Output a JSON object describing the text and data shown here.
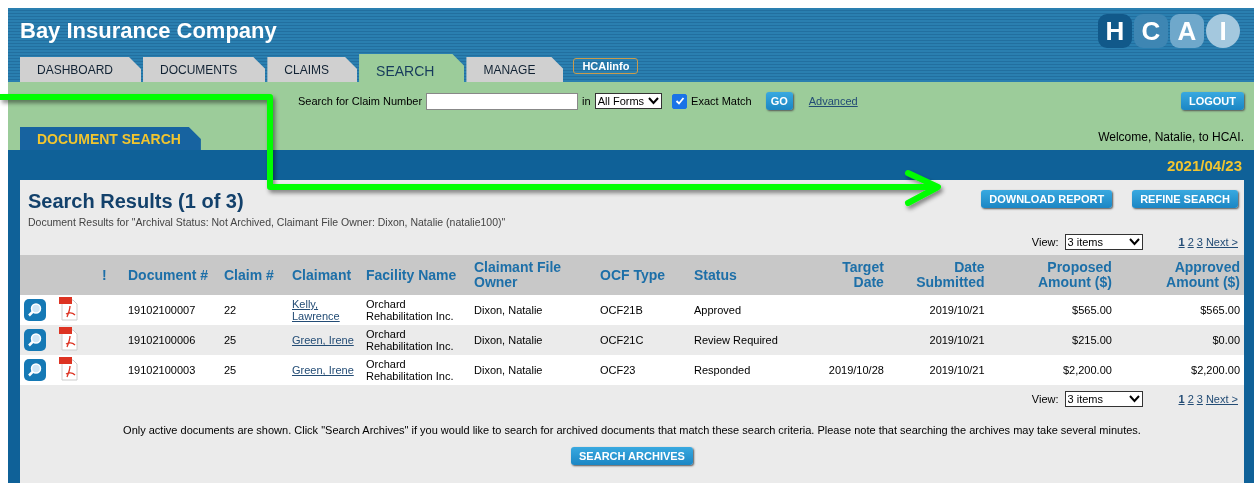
{
  "header": {
    "title": "Bay Insurance Company",
    "logo_letters": [
      "H",
      "C",
      "A",
      "I"
    ]
  },
  "tabs": [
    {
      "label": "DASHBOARD",
      "selected": false
    },
    {
      "label": "DOCUMENTS",
      "selected": false
    },
    {
      "label": "CLAIMS",
      "selected": false
    },
    {
      "label": "SEARCH",
      "selected": true
    },
    {
      "label": "MANAGE",
      "selected": false
    }
  ],
  "info_button": "HCAIinfo",
  "claim_search": {
    "label": "Search for Claim Number",
    "in_label": "in",
    "form_select": "All Forms",
    "exact_match": {
      "label": "Exact Match",
      "checked": true
    },
    "go_button": "GO",
    "advanced_link": "Advanced"
  },
  "logout_button": "LOGOUT",
  "welcome": "Welcome, Natalie, to HCAI.",
  "section_tab": "DOCUMENT SEARCH",
  "date": "2021/04/23",
  "results": {
    "title": "Search Results (1 of 3)",
    "subtitle": "Document Results for \"Archival Status: Not Archived, Claimant File Owner: Dixon, Natalie (natalie100)\"",
    "buttons": [
      "DOWNLOAD REPORT",
      "REFINE SEARCH"
    ],
    "view_label": "View:",
    "view_select": "3 items",
    "pages": [
      {
        "label": "1",
        "selected": true
      },
      {
        "label": "2",
        "selected": false
      },
      {
        "label": "3",
        "selected": false
      }
    ],
    "next_link": "Next >"
  },
  "table": {
    "columns": [
      "!",
      "Document #",
      "Claim #",
      "Claimant",
      "Facility Name",
      "Claimant File Owner",
      "OCF Type",
      "Status",
      "Target Date",
      "Date Submitted",
      "Proposed Amount ($)",
      "Approved Amount ($)"
    ],
    "rows": [
      {
        "document": "19102100007",
        "claim": "22",
        "claimant": "Kelly, Lawrence",
        "facility": "Orchard Rehabilitation Inc.",
        "owner": "Dixon, Natalie",
        "ocf_type": "OCF21B",
        "status": "Approved",
        "submitted": "2019/10/21",
        "proposed": "$565.00",
        "approved": "$565.00"
      },
      {
        "document": "19102100006",
        "claim": "25",
        "claimant": "Green, Irene",
        "facility": "Orchard Rehabilitation Inc.",
        "owner": "Dixon, Natalie",
        "ocf_type": "OCF21C",
        "status": "Review Required",
        "submitted": "2019/10/21",
        "proposed": "$215.00",
        "approved": "$0.00"
      },
      {
        "document": "19102100003",
        "claim": "25",
        "claimant": "Green, Irene",
        "facility": "Orchard Rehabilitation Inc.",
        "owner": "Dixon, Natalie",
        "ocf_type": "OCF23",
        "status": "Responded",
        "target": "2019/10/28",
        "submitted": "2019/10/21",
        "proposed": "$2,200.00",
        "approved": "$2,200.00"
      }
    ]
  },
  "bottom_pager": {
    "view_label": "View:",
    "view_select": "3 items",
    "pages": [
      {
        "label": "1",
        "selected": true
      },
      {
        "label": "2",
        "selected": false
      },
      {
        "label": "3",
        "selected": false
      }
    ],
    "next_link": "Next >"
  },
  "note": "Only active documents are shown. Click \"Search Archives\" if you would like to search for archived documents that match these search criteria. Please note that searching the archives may take several minutes.",
  "search_archives_button": "SEARCH ARCHIVES"
}
